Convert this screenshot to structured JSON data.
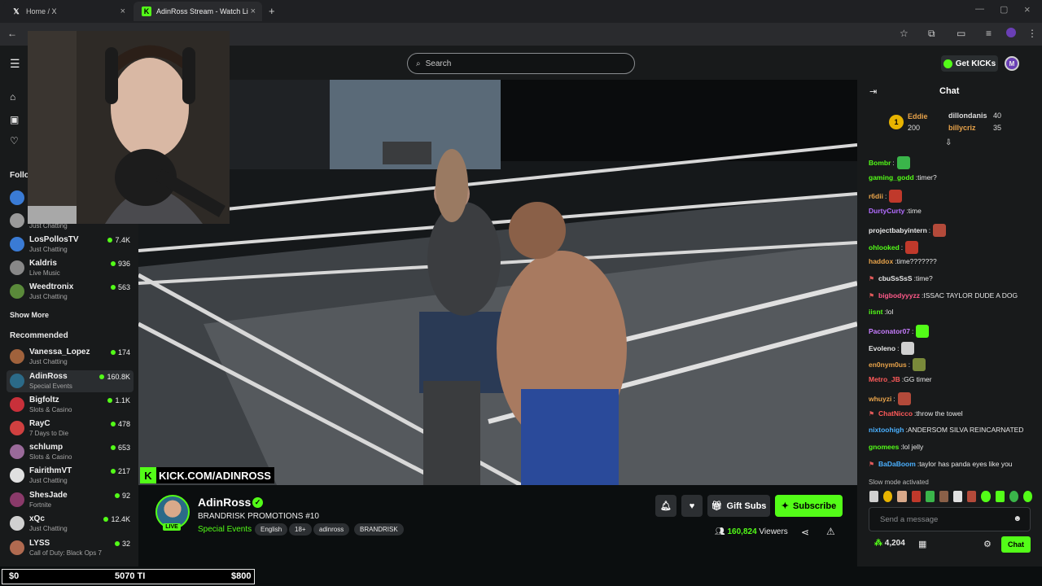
{
  "browser": {
    "tabs": [
      {
        "label": "Home / X",
        "icon": "x-logo-icon"
      },
      {
        "label": "AdinRoss Stream - Watch Li",
        "icon": "kick-logo-icon"
      }
    ]
  },
  "header": {
    "search_placeholder": "Search",
    "get_kicks": "Get KICKs",
    "user_initial": "M"
  },
  "sidebar": {
    "following_title": "Follo",
    "following_first_cat": "Just Chatting",
    "following": [
      {
        "name": "LosPollosTV",
        "category": "Just Chatting",
        "viewers": "7.4K",
        "color": "#3a7bd5"
      },
      {
        "name": "Kaldris",
        "category": "Live Music",
        "viewers": "936",
        "color": "#888888"
      },
      {
        "name": "Weedtronix",
        "category": "Just Chatting",
        "viewers": "563",
        "color": "#5a8a3a"
      }
    ],
    "show_more": "Show More",
    "recommended_title": "Recommended",
    "recommended": [
      {
        "name": "Vanessa_Lopez",
        "category": "Just Chatting",
        "viewers": "174",
        "color": "#a0623c"
      },
      {
        "name": "AdinRoss",
        "category": "Special Events",
        "viewers": "160.8K",
        "color": "#2b6a88"
      },
      {
        "name": "Bigfoltz",
        "category": "Slots & Casino",
        "viewers": "1.1K",
        "color": "#c8303a"
      },
      {
        "name": "RayC",
        "category": "7 Days to Die",
        "viewers": "478",
        "color": "#d04040"
      },
      {
        "name": "schlump",
        "category": "Slots & Casino",
        "viewers": "653",
        "color": "#9a6a9a"
      },
      {
        "name": "FairithmVT",
        "category": "Just Chatting",
        "viewers": "217",
        "color": "#e0e0e0"
      },
      {
        "name": "ShesJade",
        "category": "Fortnite",
        "viewers": "92",
        "color": "#8a3a6a"
      },
      {
        "name": "xQc",
        "category": "Just Chatting",
        "viewers": "12.4K",
        "color": "#d0d0d0"
      },
      {
        "name": "LYSS",
        "category": "Call of Duty: Black Ops 7",
        "viewers": "32",
        "color": "#b06a50"
      }
    ]
  },
  "video": {
    "watermark": "KICK.COM/ADINROSS"
  },
  "stream": {
    "streamer": "AdinRoss",
    "live": "LIVE",
    "title": "BRANDRISK PROMOTIONS #10",
    "category": "Special Events",
    "tags": [
      "English",
      "18+",
      "adinross",
      "BRANDRISK"
    ],
    "gift_subs": "Gift Subs",
    "subscribe": "Subscribe",
    "viewer_count": "160,824",
    "viewers_label": "Viewers"
  },
  "chat": {
    "title": "Chat",
    "leaderboard": [
      {
        "rank": "1",
        "name": "Eddie",
        "amount": "200"
      },
      {
        "name": "dillondanis",
        "amount": "40"
      },
      {
        "name": "billycriz",
        "amount": "35"
      }
    ],
    "messages": [
      {
        "user": "Bombr",
        "text": "",
        "color": "#53fc18",
        "emote": "#3ab54a",
        "badge": false
      },
      {
        "user": "gaming_godd",
        "text": "timer?",
        "color": "#53fc18",
        "emote": "",
        "badge": false
      },
      {
        "user": "r6dii",
        "text": "",
        "color": "#e8a34a",
        "emote": "#c0392b",
        "badge": false
      },
      {
        "user": "DurtyCurty",
        "text": "time",
        "color": "#b26cff",
        "emote": "",
        "badge": false
      },
      {
        "user": "projectbabyintern",
        "text": "",
        "color": "#e8e8e8",
        "emote": "#b34a3a",
        "badge": false
      },
      {
        "user": "ohlooked",
        "text": "",
        "color": "#53fc18",
        "emote": "#c0392b",
        "badge": false
      },
      {
        "user": "haddox",
        "text": "time???????",
        "color": "#e8a34a",
        "emote": "",
        "badge": false
      },
      {
        "user": "cbuSsSsS",
        "text": "time?",
        "color": "#e8e8e8",
        "emote": "",
        "badge": true
      },
      {
        "user": "bigbodyyyzz",
        "text": "ISSAC TAYLOR DUDE A DOG",
        "color": "#ff5a8a",
        "emote": "",
        "badge": true
      },
      {
        "user": "iisnt",
        "text": "lol",
        "color": "#53fc18",
        "emote": "",
        "badge": false
      },
      {
        "user": "Paconator07",
        "text": "",
        "color": "#c77dff",
        "emote": "#53fc18",
        "badge": false
      },
      {
        "user": "Evoleno",
        "text": "",
        "color": "#e8e8e8",
        "emote": "#d0d0d0",
        "badge": false
      },
      {
        "user": "en0nym0us",
        "text": "",
        "color": "#e8a34a",
        "emote": "#7a8a3a",
        "badge": false
      },
      {
        "user": "Metro_JB",
        "text": "GG timer",
        "color": "#ff5a5a",
        "emote": "",
        "badge": false
      },
      {
        "user": "whuyzi",
        "text": "",
        "color": "#e8a34a",
        "emote": "#b34a3a",
        "badge": false
      },
      {
        "user": "ChatNicco",
        "text": "throw the towel",
        "color": "#ff5a5a",
        "emote": "",
        "badge": true
      },
      {
        "user": "nixtoohigh",
        "text": "ANDERSOM SILVA REINCARNATED",
        "color": "#4ab0ff",
        "emote": "",
        "badge": false
      },
      {
        "user": "gnomees",
        "text": "lol jelly",
        "color": "#53fc18",
        "emote": "",
        "badge": false
      },
      {
        "user": "BaDaBoom",
        "text": "taylor has panda eyes like you",
        "color": "#4ab0ff",
        "emote": "",
        "badge": true
      }
    ],
    "slow_mode": "Slow mode activated",
    "input_placeholder": "Send a message",
    "kicks": "4,204",
    "send": "Chat"
  },
  "overlay_bar": {
    "left": "$0",
    "middle": "5070 TI",
    "right": "$800"
  }
}
